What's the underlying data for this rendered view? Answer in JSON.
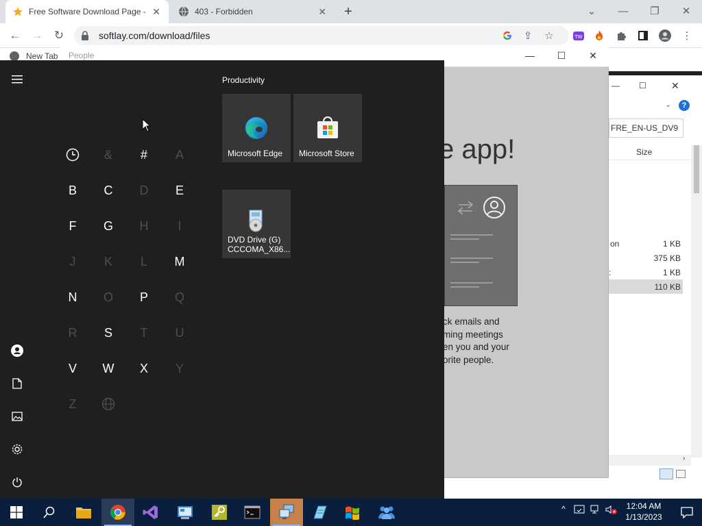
{
  "browser": {
    "tabs": [
      {
        "title": "Free Software Download Page - ",
        "icon": "star-icon",
        "active": true
      },
      {
        "title": "403 - Forbidden",
        "icon": "globe-icon",
        "active": false
      }
    ],
    "new_tab_symbol": "+",
    "url": "softlay.com/download/files",
    "bookmark": "New Tab"
  },
  "people_window": {
    "title": "People",
    "headline": "e app!",
    "body_lines": [
      "ck emails and",
      "ming meetings",
      "en you and your",
      "orite people."
    ]
  },
  "file_explorer": {
    "search_text": "FRE_EN-US_DV9",
    "column_header": "Size",
    "rows": [
      {
        "name": "on",
        "size": "1 KB"
      },
      {
        "name": "",
        "size": "375 KB"
      },
      {
        "name": ":",
        "size": "1 KB"
      },
      {
        "name": "",
        "size": "110 KB",
        "selected": true
      }
    ]
  },
  "start_menu": {
    "letters": [
      {
        "char": "◷",
        "enabled": true,
        "kind": "recent-clock"
      },
      {
        "char": "&",
        "enabled": false
      },
      {
        "char": "#",
        "enabled": true
      },
      {
        "char": "A",
        "enabled": false
      },
      {
        "char": "B",
        "enabled": true
      },
      {
        "char": "C",
        "enabled": true
      },
      {
        "char": "D",
        "enabled": false
      },
      {
        "char": "E",
        "enabled": true
      },
      {
        "char": "F",
        "enabled": true
      },
      {
        "char": "G",
        "enabled": true
      },
      {
        "char": "H",
        "enabled": false
      },
      {
        "char": "I",
        "enabled": false
      },
      {
        "char": "J",
        "enabled": false
      },
      {
        "char": "K",
        "enabled": false
      },
      {
        "char": "L",
        "enabled": false
      },
      {
        "char": "M",
        "enabled": true
      },
      {
        "char": "N",
        "enabled": true
      },
      {
        "char": "O",
        "enabled": false
      },
      {
        "char": "P",
        "enabled": true
      },
      {
        "char": "Q",
        "enabled": false
      },
      {
        "char": "R",
        "enabled": false
      },
      {
        "char": "S",
        "enabled": true
      },
      {
        "char": "T",
        "enabled": false
      },
      {
        "char": "U",
        "enabled": false
      },
      {
        "char": "V",
        "enabled": true
      },
      {
        "char": "W",
        "enabled": true
      },
      {
        "char": "X",
        "enabled": true
      },
      {
        "char": "Y",
        "enabled": false
      },
      {
        "char": "Z",
        "enabled": false
      },
      {
        "char": "⊕",
        "enabled": false,
        "kind": "globe"
      }
    ],
    "group_title": "Productivity",
    "tiles": [
      {
        "label": "Microsoft Edge",
        "icon": "edge-icon"
      },
      {
        "label": "Microsoft Store",
        "icon": "store-icon"
      },
      {
        "label": "DVD Drive (G) CCCOMA_X86...",
        "icon": "dvd-drive-icon"
      }
    ],
    "left_rail": [
      "hamburger-menu-icon",
      "user-icon",
      "document-icon",
      "pictures-icon",
      "settings-gear-icon",
      "power-icon"
    ]
  },
  "taskbar": {
    "clock_time": "12:04 AM",
    "clock_date": "1/13/2023",
    "pinned": [
      "windows-start-icon",
      "search-icon",
      "file-explorer-icon",
      "chrome-icon",
      "visual-studio-icon",
      "app-icon",
      "key-app-icon",
      "terminal-icon",
      "remote-desktop-icon",
      "notepad-icon",
      "windows-flag-icon",
      "people-icon"
    ]
  }
}
